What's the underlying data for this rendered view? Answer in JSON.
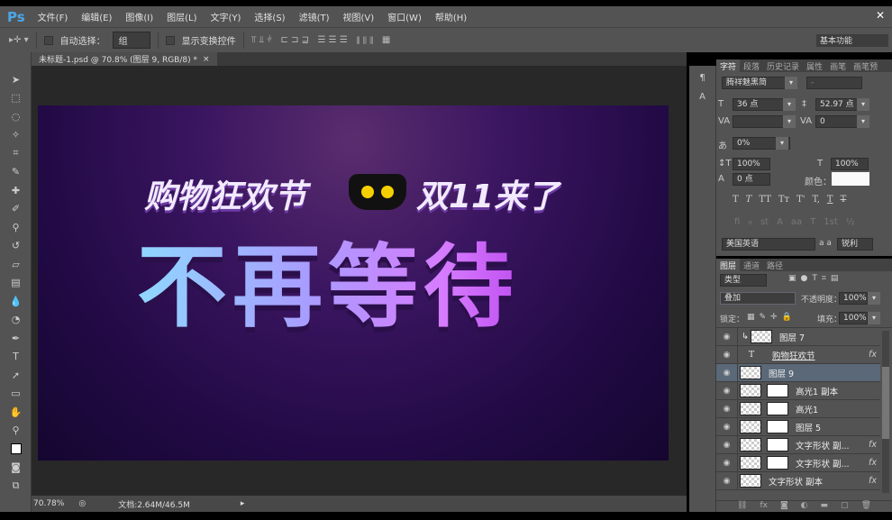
{
  "app": {
    "logo": "Ps",
    "menu": [
      "文件(F)",
      "编辑(E)",
      "图像(I)",
      "图层(L)",
      "文字(Y)",
      "选择(S)",
      "滤镜(T)",
      "视图(V)",
      "窗口(W)",
      "帮助(H)"
    ],
    "workspace": "基本功能"
  },
  "options": {
    "auto_select_label": "自动选择：",
    "auto_select_value": "组",
    "show_transform_label": "显示变换控件"
  },
  "document": {
    "tab_title": "未标题-1.psd @ 70.8% (图层 9, RGB/8) *",
    "close": "×"
  },
  "artwork": {
    "line1": "购物狂欢节",
    "line1b": "双11来了",
    "line2": "不再等待"
  },
  "status": {
    "zoom": "70.78%",
    "doc": "文档:2.64M/46.5M"
  },
  "character_panel": {
    "tabs": [
      "字符",
      "段落",
      "历史记录",
      "属性",
      "画笔",
      "画笔预"
    ],
    "font": "腾祥魅黑简",
    "style": "-",
    "size": "36 点",
    "leading": "52.97 点",
    "kerning": "",
    "tracking": "0",
    "scale_ratio": "0%",
    "vscale": "100%",
    "hscale": "100%",
    "baseline": "0 点",
    "color_label": "颜色：",
    "type_buttons": [
      "T",
      "T",
      "TT",
      "Tт",
      "T'",
      "T,",
      "T",
      "T"
    ],
    "opentype_buttons": [
      "fi",
      "ℴ",
      "st",
      "A",
      "aa",
      "T",
      "1st",
      "½"
    ],
    "language": "美国英语",
    "aa_label": "a a",
    "antialias": "锐利"
  },
  "layers_panel": {
    "tabs": [
      "图层",
      "通道",
      "路径"
    ],
    "filter": "类型",
    "blend_mode": "叠加",
    "opacity_label": "不透明度：",
    "opacity": "100%",
    "lock_label": "锁定：",
    "fill_label": "填充：",
    "fill": "100%",
    "layers": [
      {
        "name": "图层 7",
        "type": "clip"
      },
      {
        "name": "购物狂欢节",
        "type": "text",
        "fx": "fx"
      },
      {
        "name": "图层 9",
        "type": "selected"
      },
      {
        "name": "高光1 副本",
        "type": "mask"
      },
      {
        "name": "高光1",
        "type": "mask"
      },
      {
        "name": "图层 5",
        "type": "mask"
      },
      {
        "name": "文字形状 副...",
        "type": "mask",
        "fx": "fx"
      },
      {
        "name": "文字形状 副...",
        "type": "mask",
        "fx": "fx"
      },
      {
        "name": "文字形状 副本",
        "type": "plain",
        "fx": "fx"
      }
    ]
  }
}
